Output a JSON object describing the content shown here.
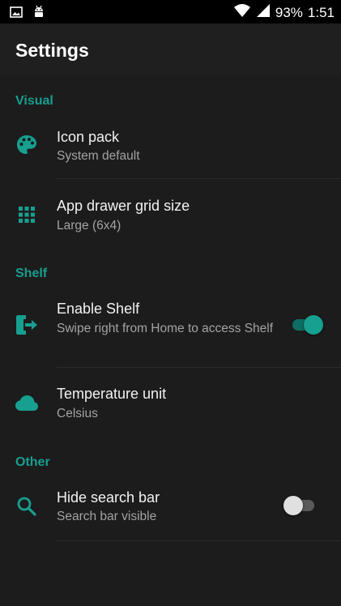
{
  "status_bar": {
    "left_icons": [
      "image-icon",
      "android-icon"
    ],
    "battery": "93%",
    "time": "1:51"
  },
  "toolbar": {
    "title": "Settings"
  },
  "sections": [
    {
      "title": "Visual",
      "items": [
        {
          "label": "Icon pack",
          "subtitle": "System default",
          "icon": "palette-icon"
        },
        {
          "label": "App drawer grid size",
          "subtitle": "Large (6x4)",
          "icon": "grid-icon"
        }
      ]
    },
    {
      "title": "Shelf",
      "items": [
        {
          "label": "Enable Shelf",
          "subtitle": "Swipe right from Home to access Shelf",
          "icon": "exit-icon",
          "toggle": true
        },
        {
          "label": "Temperature unit",
          "subtitle": "Celsius",
          "icon": "cloud-icon"
        }
      ]
    },
    {
      "title": "Other",
      "items": [
        {
          "label": "Hide search bar",
          "subtitle": "Search bar visible",
          "icon": "search-icon",
          "toggle": false
        }
      ]
    }
  ],
  "colors": {
    "accent": "#179f90",
    "background": "#1c1c1c",
    "toolbar": "#1f1f1f"
  }
}
